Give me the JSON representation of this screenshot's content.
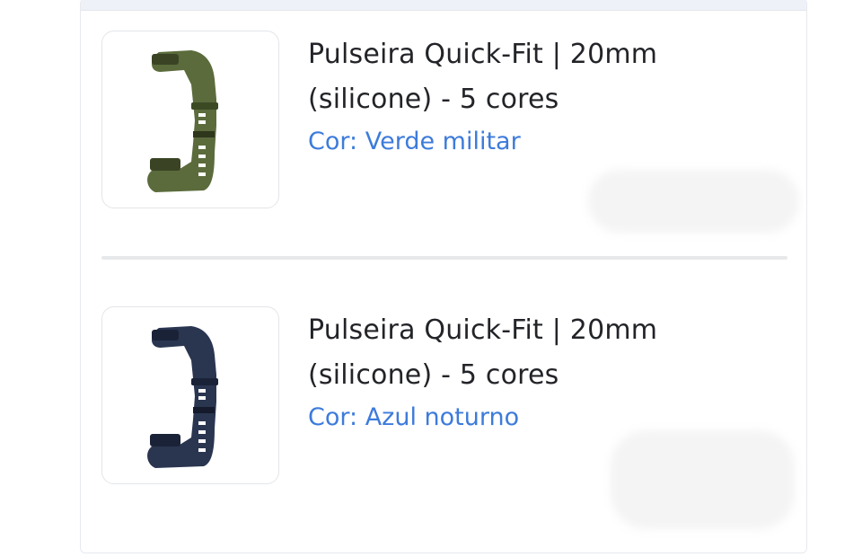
{
  "cart": {
    "items": [
      {
        "title": "Pulseira Quick-Fit | 20mm (silicone) - 5 cores",
        "variant_label": "Cor:",
        "variant_value": "Verde militar",
        "image_icon": "watch-band-icon",
        "band_color": "#5b6b3c"
      },
      {
        "title": "Pulseira Quick-Fit | 20mm (silicone) - 5 cores",
        "variant_label": "Cor:",
        "variant_value": "Azul noturno",
        "image_icon": "watch-band-icon",
        "band_color": "#2a3550"
      }
    ]
  },
  "colors": {
    "link": "#3d7bdb",
    "text": "#222428",
    "border": "#e3e5e9"
  }
}
